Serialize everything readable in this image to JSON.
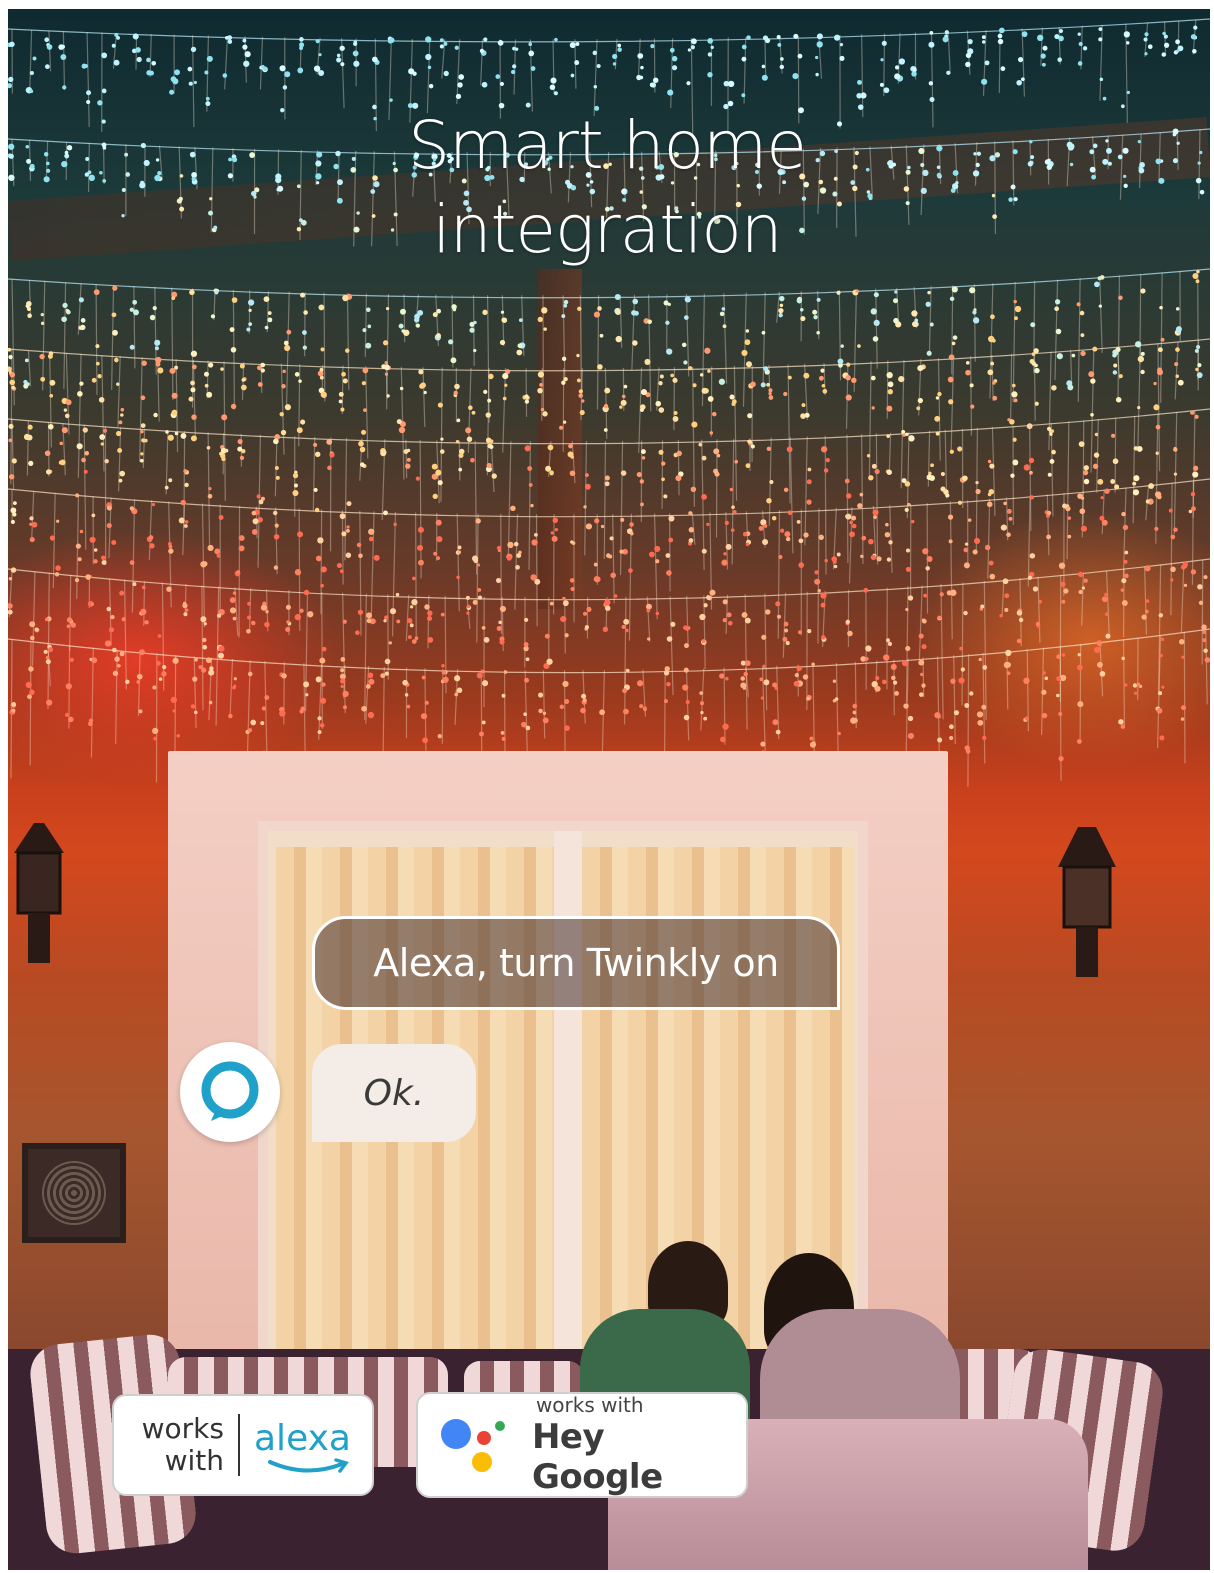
{
  "headline": {
    "line1": "Smart home",
    "line2": "integration"
  },
  "conversation": {
    "user_message": "Alexa, turn Twinkly on",
    "assistant_reply": "Ok.",
    "assistant_icon": "alexa-ring-icon",
    "accent_color": "#1fa1c9"
  },
  "badges": {
    "alexa": {
      "works_with": "works with",
      "works": "works",
      "with": "with",
      "brand": "alexa",
      "brand_color": "#1fa1c9"
    },
    "google": {
      "works_with": "works with",
      "brand": "Hey Google",
      "dot_colors": [
        "#4285F4",
        "#EA4335",
        "#FBBC05",
        "#34A853"
      ]
    }
  }
}
